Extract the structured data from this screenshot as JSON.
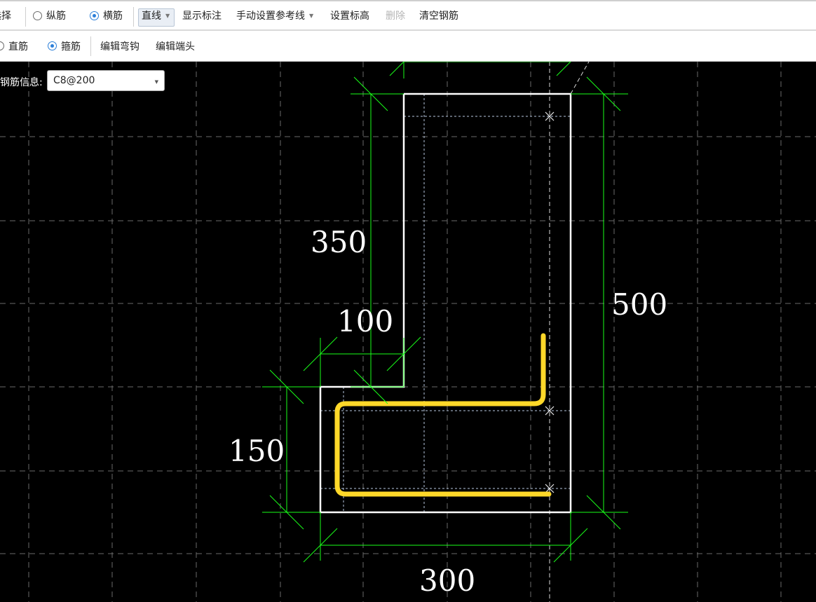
{
  "toolbar1": {
    "select_label": "选择",
    "longitudinal_label": "纵筋",
    "transverse_label": "横筋",
    "line_mode_label": "直线",
    "show_dims_label": "显示标注",
    "manual_ref_label": "手动设置参考线",
    "set_elevation_label": "设置标高",
    "delete_label": "删除",
    "clear_label": "清空钢筋"
  },
  "toolbar2": {
    "straight_label": "直筋",
    "stirrup_label": "箍筋",
    "edit_hook_label": "编辑弯钩",
    "edit_end_label": "编辑端头"
  },
  "rebar_info": {
    "label": "钢筋信息:",
    "value": "C8@200"
  },
  "drawing": {
    "dimensions": {
      "upper_height": "350",
      "total_height": "500",
      "step_width": "100",
      "lower_height": "150",
      "total_width": "300"
    },
    "colors": {
      "background": "#000000",
      "outline": "#ffffff",
      "dimension": "#00ff00",
      "rebar": "#ffd829",
      "grid": "#6a6a6a"
    }
  }
}
